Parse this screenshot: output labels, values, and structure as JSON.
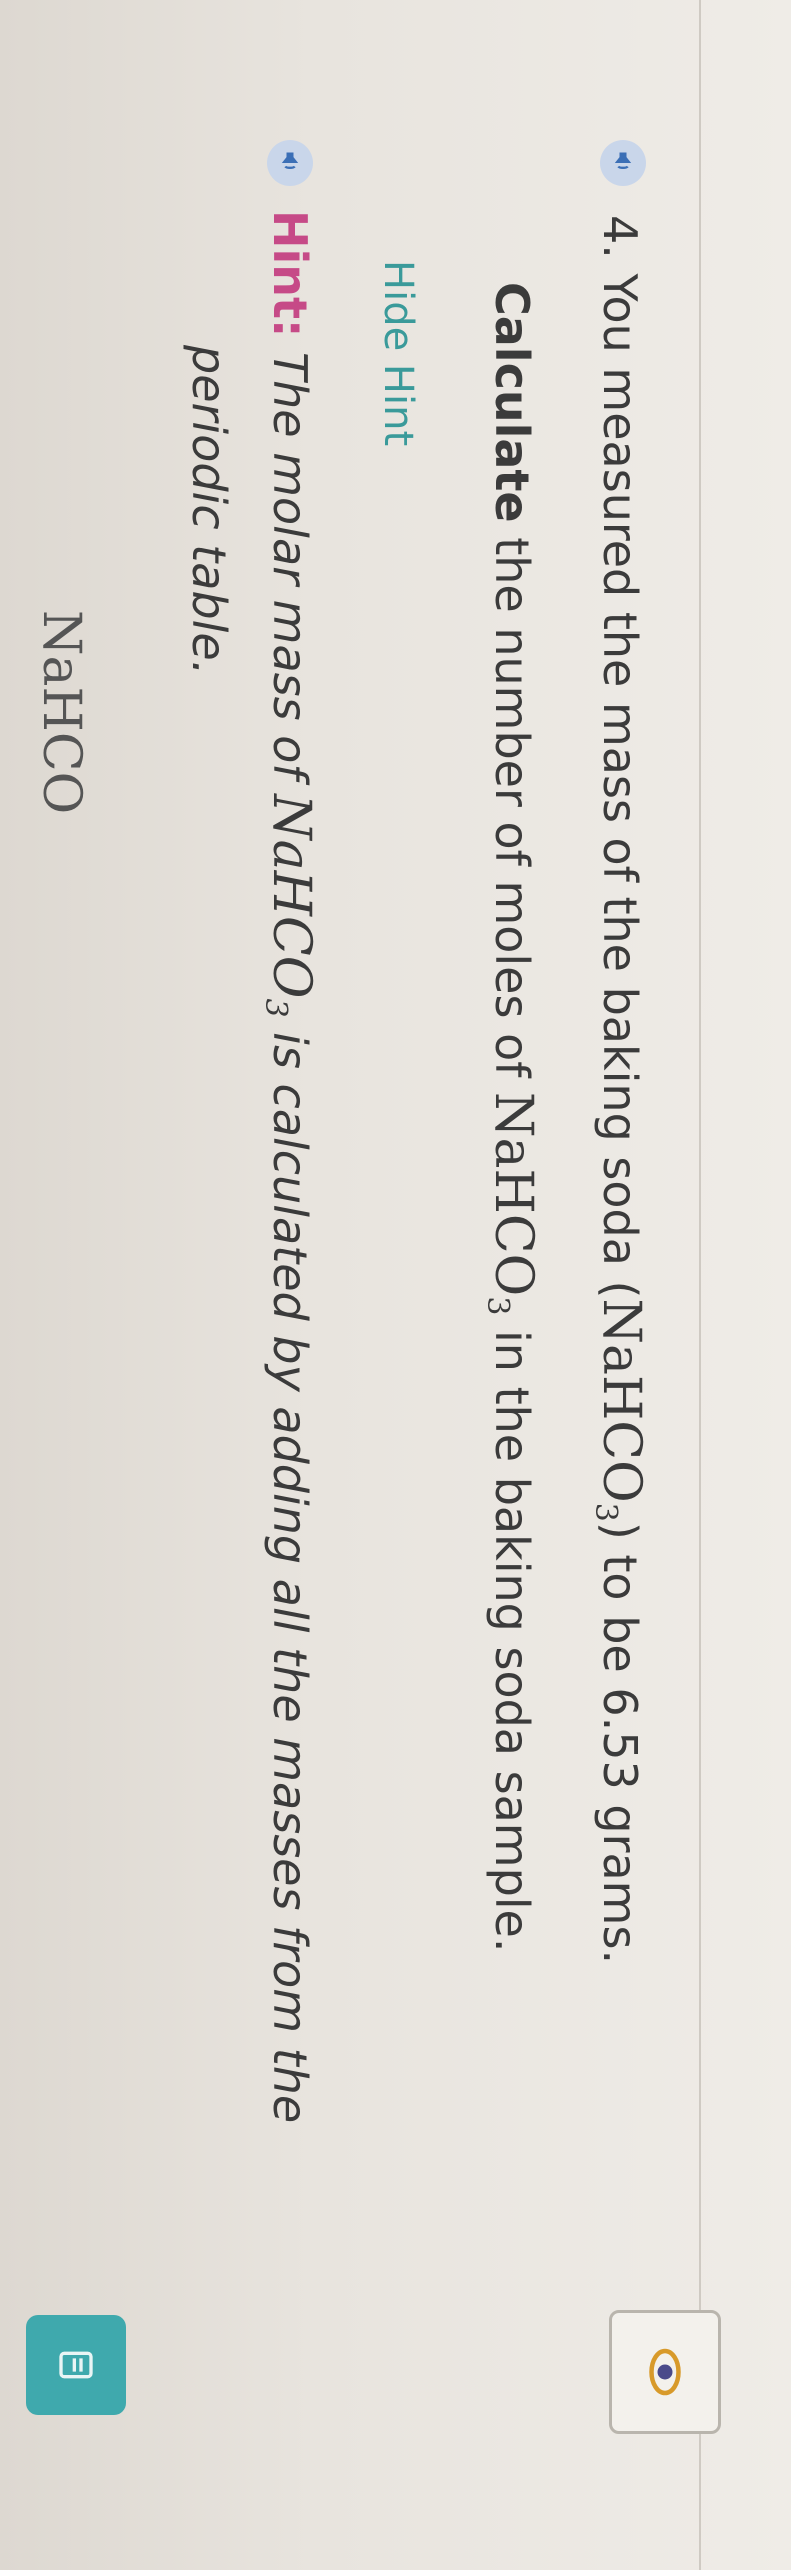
{
  "question": {
    "number": "4.",
    "text_before": "You measured the mass of the baking soda (",
    "formula_main": "NaHCO",
    "formula_sub": "3",
    "text_after": ") to be 6.53 grams."
  },
  "calculate": {
    "bold": "Calculate",
    "text_before": " the number of moles of ",
    "formula_main": "NaHCO",
    "formula_sub": "3",
    "text_after": " in the baking soda sample."
  },
  "hint_toggle_label": "Hide Hint",
  "hint": {
    "label": "Hint:",
    "text_before": " The molar mass of ",
    "formula_main": "NaHCO",
    "formula_sub": "3",
    "text_after": " is calculated by adding all the masses from the",
    "line2": "periodic table."
  },
  "partial_text": "NaHCO",
  "icons": {
    "speaker": "speaker-icon",
    "orbit": "orbit-icon",
    "teal_button": "document-icon"
  },
  "colors": {
    "hint_label": "#c64a87",
    "hide_hint": "#3a9a9a",
    "teal_button": "#3fa9ad",
    "speaker_bg": "#c9d6ea"
  }
}
